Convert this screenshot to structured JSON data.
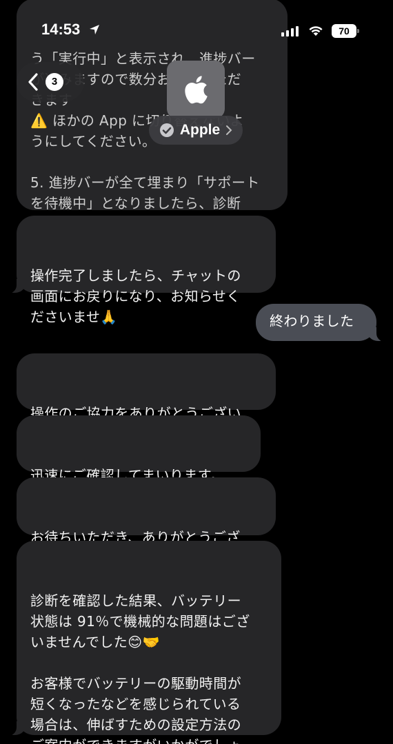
{
  "status_bar": {
    "time": "14:53",
    "battery": "70"
  },
  "header": {
    "back_count": "3",
    "contact_name": "Apple"
  },
  "messages": {
    "partial_top": "う「実行中」と表示され、進捗バー\nが進みますので数分お待ちいただ\nきます\n⚠️ ほかの App に切り替えないよ\nうにしてください。\n\n5. 進捗バーが全て埋まり「サポート\nを待機中」となりましたら、診断\nの画面は「...」マークから終了や、\n× ボタンや「閉じる」で終了してく\nださい。",
    "m1": "操作完了しましたら、チャットの\n画面にお戻りになり、お知らせく\nださいませ🙏",
    "out1": "終わりました",
    "m2": "操作のご協力をありがとうござい\nます🤝",
    "m3": "迅速にご確認してまいります。\n少々お待ちください。",
    "m4": "お待ちいただき、ありがとうござ\nいます。",
    "m5": "診断を確認した結果、バッテリー\n状態は 91％で機械的な問題はござ\nいませんでした😊🤝\n\nお客様でバッテリーの駆動時間が\n短くなったなどを感じられている\n場合は、伸ばすための設定方法の\nご案内ができますがいかがでしょ\nうか？"
  }
}
